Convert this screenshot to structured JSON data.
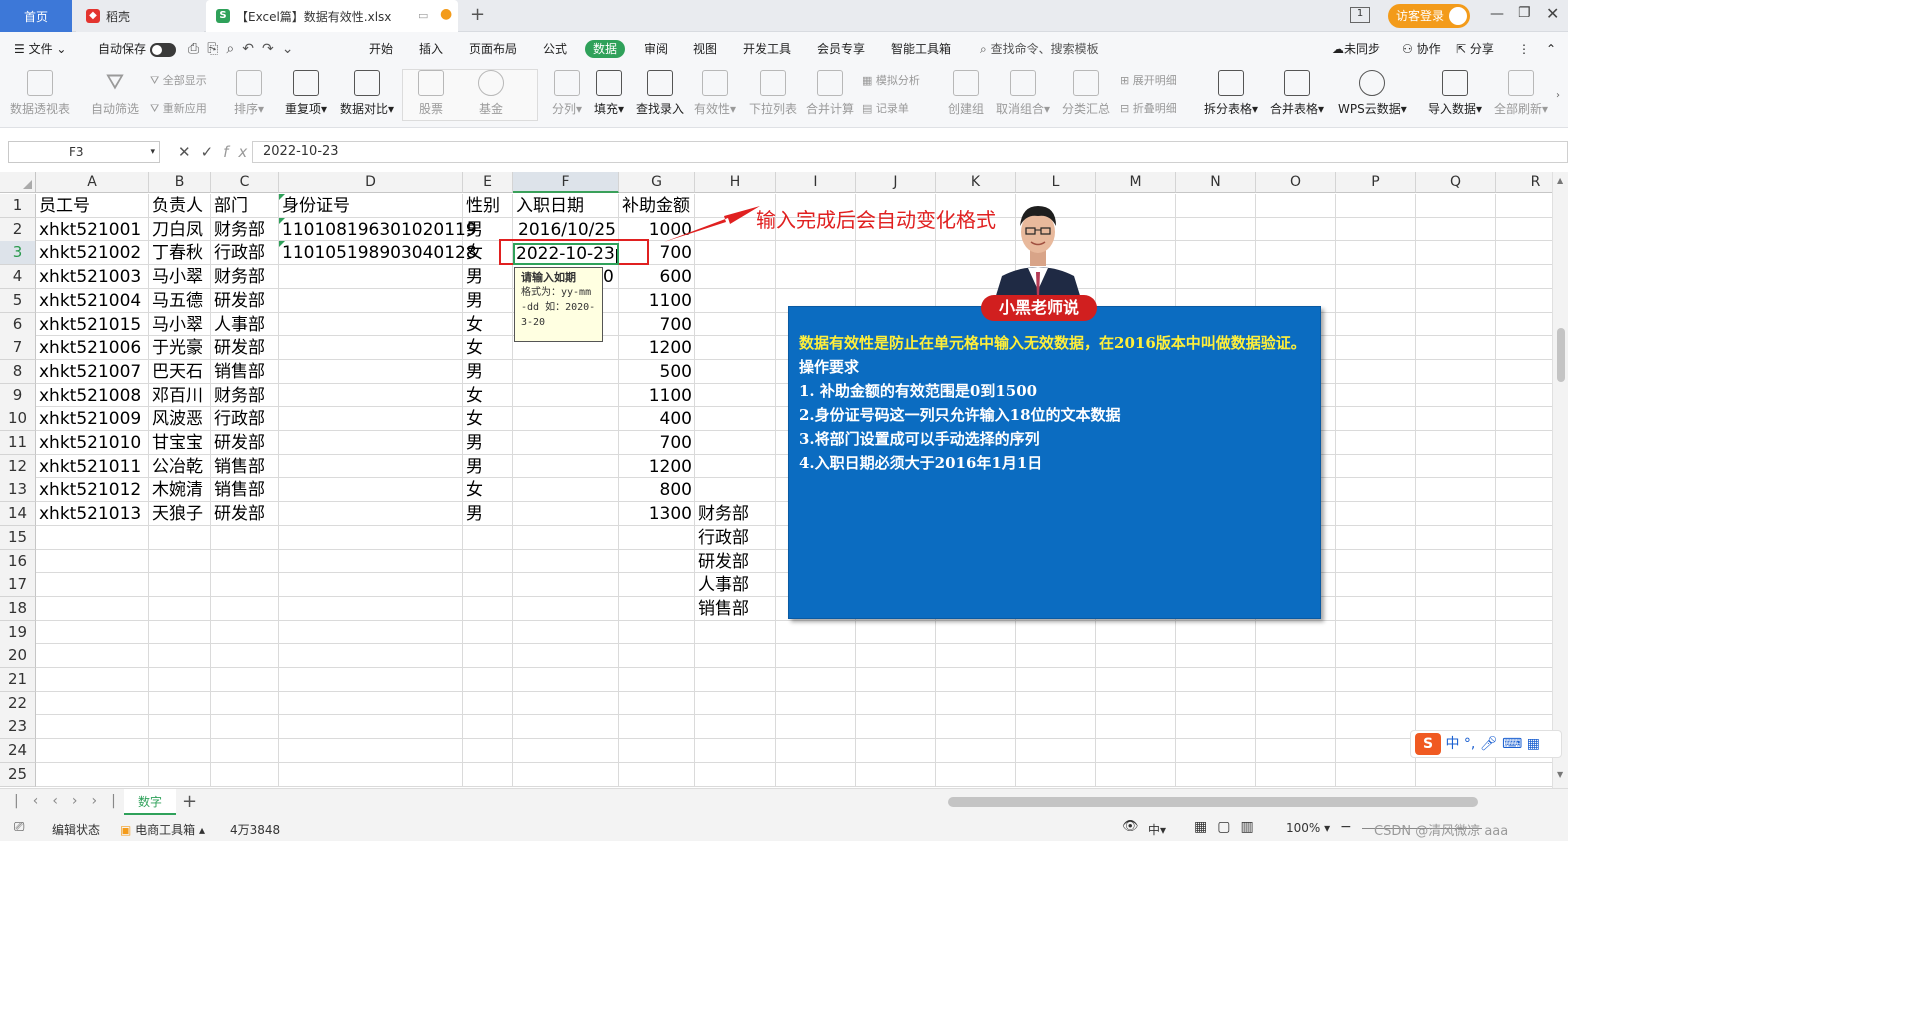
{
  "tabs": {
    "home": "首页",
    "daoke": "稻壳",
    "file": "【Excel篇】数据有效性.xlsx"
  },
  "window": {
    "login": "访客登录"
  },
  "menu": {
    "file": "文件",
    "autosave": "自动保存",
    "items": [
      "开始",
      "插入",
      "页面布局",
      "公式",
      "数据",
      "审阅",
      "视图",
      "开发工具",
      "会员专享",
      "智能工具箱"
    ],
    "search": "查找命令、搜索模板",
    "unsync": "未同步",
    "collab": "协作",
    "share": "分享"
  },
  "ribbon": {
    "pivot": "数据透视表",
    "autofilter": "自动筛选",
    "showall": "全部显示",
    "reapply": "重新应用",
    "sort": "排序",
    "dup": "重复项",
    "compare": "数据对比",
    "stock": "股票",
    "fund": "基金",
    "split": "分列",
    "fill": "填充",
    "lookup": "查找录入",
    "validity": "有效性",
    "dropdown": "下拉列表",
    "consolidate": "合并计算",
    "simulate": "模拟分析",
    "record": "记录单",
    "creategroup": "创建组",
    "ungroup": "取消组合",
    "subtotal": "分类汇总",
    "expand": "展开明细",
    "collapse": "折叠明细",
    "splittable": "拆分表格",
    "mergetable": "合并表格",
    "wpscloud": "WPS云数据",
    "import": "导入数据",
    "refresh": "全部刷新"
  },
  "formula": {
    "cellref": "F3",
    "value": "2022-10-23"
  },
  "columns": [
    "A",
    "B",
    "C",
    "D",
    "E",
    "F",
    "G",
    "H",
    "I",
    "J",
    "K",
    "L",
    "M",
    "N",
    "O",
    "P",
    "Q",
    "R"
  ],
  "rows": [
    "1",
    "2",
    "3",
    "4",
    "5",
    "6",
    "7",
    "8",
    "9",
    "10",
    "11",
    "12",
    "13",
    "14",
    "15",
    "16",
    "17",
    "18",
    "19",
    "20",
    "21",
    "22",
    "23",
    "24",
    "25"
  ],
  "table": {
    "header": [
      "员工号",
      "负责人",
      "部门",
      "身份证号",
      "性别",
      "入职日期",
      "补助金额"
    ],
    "data": [
      [
        "xhkt521001",
        "刀白凤",
        "财务部",
        "110108196301020119",
        "男",
        "2016/10/25",
        "1000"
      ],
      [
        "xhkt521002",
        "丁春秋",
        "行政部",
        "110105198903040128",
        "女",
        "2022-10-23",
        "700"
      ],
      [
        "xhkt521003",
        "马小翠",
        "财务部",
        "",
        "男",
        "",
        "600"
      ],
      [
        "xhkt521004",
        "马五德",
        "研发部",
        "",
        "男",
        "",
        "1100"
      ],
      [
        "xhkt521015",
        "马小翠",
        "人事部",
        "",
        "女",
        "",
        "700"
      ],
      [
        "xhkt521006",
        "于光豪",
        "研发部",
        "",
        "女",
        "",
        "1200"
      ],
      [
        "xhkt521007",
        "巴天石",
        "销售部",
        "",
        "男",
        "",
        "500"
      ],
      [
        "xhkt521008",
        "邓百川",
        "财务部",
        "",
        "女",
        "",
        "1100"
      ],
      [
        "xhkt521009",
        "风波恶",
        "行政部",
        "",
        "女",
        "",
        "400"
      ],
      [
        "xhkt521010",
        "甘宝宝",
        "研发部",
        "",
        "男",
        "",
        "700"
      ],
      [
        "xhkt521011",
        "公冶乾",
        "销售部",
        "",
        "男",
        "",
        "1200"
      ],
      [
        "xhkt521012",
        "木婉清",
        "销售部",
        "",
        "女",
        "",
        "800"
      ],
      [
        "xhkt521013",
        "天狼子",
        "研发部",
        "",
        "男",
        "",
        "1300"
      ]
    ],
    "dept_list": [
      "财务部",
      "行政部",
      "研发部",
      "人事部",
      "销售部"
    ],
    "stray_zero": "0"
  },
  "tooltip": {
    "title": "请输入如期",
    "body": "格式为：yy-mm-dd 如：2020-3-20"
  },
  "annotation": "输入完成后会自动变化格式",
  "teacher": {
    "name": "小黑老师说",
    "lines": [
      "数据有效性是防止在单元格中输入无效数据，在2016版本中叫做数据验证。",
      "操作要求",
      "1. 补助金额的有效范围是0到1500",
      "2.身份证号码这一列只允许输入18位的文本数据",
      "3.将部门设置成可以手动选择的序列",
      "4.入职日期必须大于2016年1月1日"
    ]
  },
  "sheet_tab": "数字",
  "status": {
    "mode": "编辑状态",
    "toolbox": "电商工具箱",
    "count": "4万3848",
    "zoom": "100%",
    "ime": "中",
    "watermark": "CSDN @清风微凉 aaa"
  },
  "colors": {
    "accent_green": "#2fa15a",
    "home_tab": "#3d78d8",
    "panel_blue": "#0b6cc1",
    "panel_yellow": "#ffef3a",
    "name_red": "#d11f1f",
    "annotation_red": "#e02020"
  }
}
